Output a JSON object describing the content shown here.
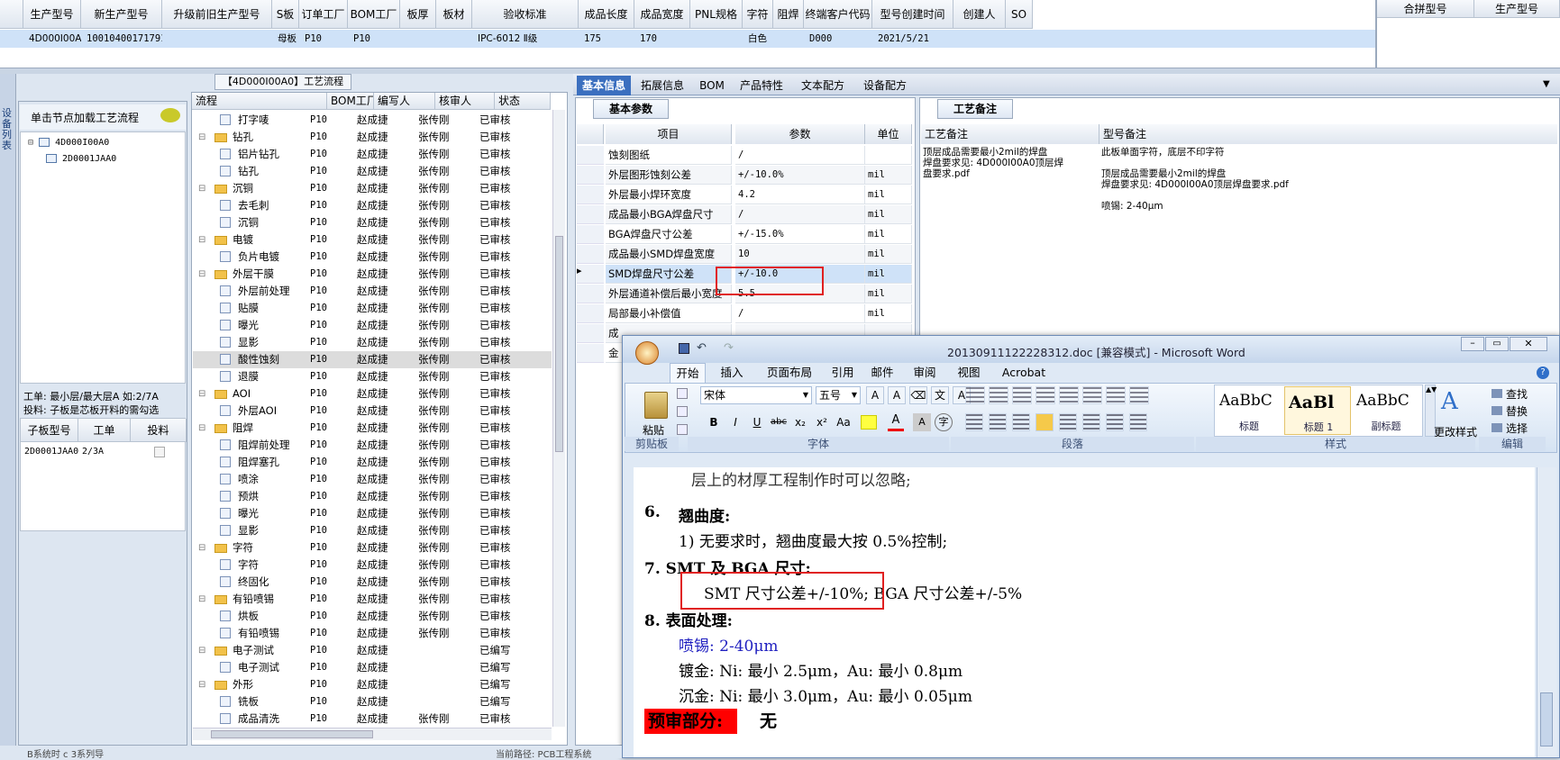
{
  "top_grid": {
    "headers": [
      "生产型号",
      "新生产型号",
      "升级前旧生产型号",
      "S板",
      "订单工厂",
      "BOM工厂",
      "板厚",
      "板材",
      "验收标准",
      "成品长度",
      "成品宽度",
      "PNL规格",
      "字符",
      "阻焊",
      "终端客户代码",
      "型号创建时间",
      "创建人",
      "SO"
    ],
    "row": [
      "4D000I00A0",
      "10010400171791",
      "",
      "母板",
      "P10",
      "P10",
      "",
      "",
      "IPC-6012 Ⅱ级",
      "175",
      "170",
      "",
      "白色",
      "",
      "D000",
      "2021/5/21",
      "",
      ""
    ],
    "right_headers": [
      "合拼型号",
      "生产型号"
    ]
  },
  "left_panel": {
    "vertical_label": "设备列表",
    "hint": "单击节点加载工艺流程",
    "tree": [
      "4D000I00A0",
      "2D0001JAA0"
    ],
    "info_line1": "工单: 最小层/最大层A 如:2/7A",
    "info_line2": "投料: 子板是芯板开料的需勾选",
    "sub_headers": [
      "子板型号",
      "工单",
      "投料"
    ],
    "sub_row": [
      "2D0001JAA0",
      "2/3A",
      ""
    ]
  },
  "process": {
    "title": "【4D000I00A0】工艺流程",
    "headers": [
      "流程",
      "BOM工厂",
      "编写人",
      "核审人",
      "状态"
    ],
    "rows": [
      {
        "name": "打字唛",
        "level": 2,
        "bom": "P10",
        "writer": "赵成捷",
        "reviewer": "张传刚",
        "status": "已审核"
      },
      {
        "name": "钻孔",
        "level": 1,
        "bom": "P10",
        "writer": "赵成捷",
        "reviewer": "张传刚",
        "status": "已审核"
      },
      {
        "name": "铝片钻孔",
        "level": 2,
        "bom": "P10",
        "writer": "赵成捷",
        "reviewer": "张传刚",
        "status": "已审核"
      },
      {
        "name": "钻孔",
        "level": 2,
        "bom": "P10",
        "writer": "赵成捷",
        "reviewer": "张传刚",
        "status": "已审核"
      },
      {
        "name": "沉铜",
        "level": 1,
        "bom": "P10",
        "writer": "赵成捷",
        "reviewer": "张传刚",
        "status": "已审核"
      },
      {
        "name": "去毛刺",
        "level": 2,
        "bom": "P10",
        "writer": "赵成捷",
        "reviewer": "张传刚",
        "status": "已审核"
      },
      {
        "name": "沉铜",
        "level": 2,
        "bom": "P10",
        "writer": "赵成捷",
        "reviewer": "张传刚",
        "status": "已审核"
      },
      {
        "name": "电镀",
        "level": 1,
        "bom": "P10",
        "writer": "赵成捷",
        "reviewer": "张传刚",
        "status": "已审核"
      },
      {
        "name": "负片电镀",
        "level": 2,
        "bom": "P10",
        "writer": "赵成捷",
        "reviewer": "张传刚",
        "status": "已审核"
      },
      {
        "name": "外层干膜",
        "level": 1,
        "bom": "P10",
        "writer": "赵成捷",
        "reviewer": "张传刚",
        "status": "已审核"
      },
      {
        "name": "外层前处理",
        "level": 2,
        "bom": "P10",
        "writer": "赵成捷",
        "reviewer": "张传刚",
        "status": "已审核"
      },
      {
        "name": "贴膜",
        "level": 2,
        "bom": "P10",
        "writer": "赵成捷",
        "reviewer": "张传刚",
        "status": "已审核"
      },
      {
        "name": "曝光",
        "level": 2,
        "bom": "P10",
        "writer": "赵成捷",
        "reviewer": "张传刚",
        "status": "已审核"
      },
      {
        "name": "显影",
        "level": 2,
        "bom": "P10",
        "writer": "赵成捷",
        "reviewer": "张传刚",
        "status": "已审核"
      },
      {
        "name": "酸性蚀刻",
        "level": 2,
        "bom": "P10",
        "writer": "赵成捷",
        "reviewer": "张传刚",
        "status": "已审核",
        "selected": true
      },
      {
        "name": "退膜",
        "level": 2,
        "bom": "P10",
        "writer": "赵成捷",
        "reviewer": "张传刚",
        "status": "已审核"
      },
      {
        "name": "AOI",
        "level": 1,
        "bom": "P10",
        "writer": "赵成捷",
        "reviewer": "张传刚",
        "status": "已审核"
      },
      {
        "name": "外层AOI",
        "level": 2,
        "bom": "P10",
        "writer": "赵成捷",
        "reviewer": "张传刚",
        "status": "已审核"
      },
      {
        "name": "阻焊",
        "level": 1,
        "bom": "P10",
        "writer": "赵成捷",
        "reviewer": "张传刚",
        "status": "已审核"
      },
      {
        "name": "阻焊前处理",
        "level": 2,
        "bom": "P10",
        "writer": "赵成捷",
        "reviewer": "张传刚",
        "status": "已审核"
      },
      {
        "name": "阻焊塞孔",
        "level": 2,
        "bom": "P10",
        "writer": "赵成捷",
        "reviewer": "张传刚",
        "status": "已审核"
      },
      {
        "name": "喷涂",
        "level": 2,
        "bom": "P10",
        "writer": "赵成捷",
        "reviewer": "张传刚",
        "status": "已审核"
      },
      {
        "name": "预烘",
        "level": 2,
        "bom": "P10",
        "writer": "赵成捷",
        "reviewer": "张传刚",
        "status": "已审核"
      },
      {
        "name": "曝光",
        "level": 2,
        "bom": "P10",
        "writer": "赵成捷",
        "reviewer": "张传刚",
        "status": "已审核"
      },
      {
        "name": "显影",
        "level": 2,
        "bom": "P10",
        "writer": "赵成捷",
        "reviewer": "张传刚",
        "status": "已审核"
      },
      {
        "name": "字符",
        "level": 1,
        "bom": "P10",
        "writer": "赵成捷",
        "reviewer": "张传刚",
        "status": "已审核"
      },
      {
        "name": "字符",
        "level": 2,
        "bom": "P10",
        "writer": "赵成捷",
        "reviewer": "张传刚",
        "status": "已审核"
      },
      {
        "name": "终固化",
        "level": 2,
        "bom": "P10",
        "writer": "赵成捷",
        "reviewer": "张传刚",
        "status": "已审核"
      },
      {
        "name": "有铅喷锡",
        "level": 1,
        "bom": "P10",
        "writer": "赵成捷",
        "reviewer": "张传刚",
        "status": "已审核"
      },
      {
        "name": "烘板",
        "level": 2,
        "bom": "P10",
        "writer": "赵成捷",
        "reviewer": "张传刚",
        "status": "已审核"
      },
      {
        "name": "有铅喷锡",
        "level": 2,
        "bom": "P10",
        "writer": "赵成捷",
        "reviewer": "张传刚",
        "status": "已审核"
      },
      {
        "name": "电子测试",
        "level": 1,
        "bom": "P10",
        "writer": "赵成捷",
        "reviewer": "",
        "status": "已编写"
      },
      {
        "name": "电子测试",
        "level": 2,
        "bom": "P10",
        "writer": "赵成捷",
        "reviewer": "",
        "status": "已编写"
      },
      {
        "name": "外形",
        "level": 1,
        "bom": "P10",
        "writer": "赵成捷",
        "reviewer": "",
        "status": "已编写"
      },
      {
        "name": "铣板",
        "level": 2,
        "bom": "P10",
        "writer": "赵成捷",
        "reviewer": "",
        "status": "已编写"
      },
      {
        "name": "成品清洗",
        "level": 2,
        "bom": "P10",
        "writer": "赵成捷",
        "reviewer": "张传刚",
        "status": "已审核"
      }
    ]
  },
  "tabs": [
    "基本信息",
    "拓展信息",
    "BOM",
    "产品特性",
    "文本配方",
    "设备配方"
  ],
  "basic": {
    "tab": "基本参数",
    "headers": [
      "项目",
      "参数",
      "单位"
    ],
    "rows": [
      {
        "item": "蚀刻图纸",
        "value": "/",
        "unit": ""
      },
      {
        "item": "外层图形蚀刻公差",
        "value": "+/-10.0%",
        "unit": "mil"
      },
      {
        "item": "外层最小焊环宽度",
        "value": "4.2",
        "unit": "mil"
      },
      {
        "item": "成品最小BGA焊盘尺寸",
        "value": "/",
        "unit": "mil"
      },
      {
        "item": "BGA焊盘尺寸公差",
        "value": "+/-15.0%",
        "unit": "mil"
      },
      {
        "item": "成品最小SMD焊盘宽度",
        "value": "10",
        "unit": "mil"
      },
      {
        "item": "SMD焊盘尺寸公差",
        "value": "+/-10.0",
        "unit": "mil"
      },
      {
        "item": "外层通道补偿后最小宽度",
        "value": "5.5",
        "unit": "mil"
      },
      {
        "item": "局部最小补偿值",
        "value": "/",
        "unit": "mil"
      },
      {
        "item": "成",
        "value": "",
        "unit": ""
      },
      {
        "item": "金",
        "value": "",
        "unit": ""
      }
    ]
  },
  "notes": {
    "tab": "工艺备注",
    "col1": "工艺备注",
    "col2": "型号备注",
    "text1": [
      "顶层成品需要最小2mil的焊盘",
      "焊盘要求见: 4D000I00A0顶层焊",
      "盘要求.pdf"
    ],
    "text2": [
      "此板单面字符，底层不印字符",
      "",
      "顶层成品需要最小2mil的焊盘",
      "焊盘要求见: 4D000I00A0顶层焊盘要求.pdf",
      "",
      "喷锡: 2-40μm"
    ]
  },
  "word": {
    "title": "20130911122228312.doc [兼容模式] - Microsoft Word",
    "tabs": [
      "开始",
      "插入",
      "页面布局",
      "引用",
      "邮件",
      "审阅",
      "视图",
      "Acrobat"
    ],
    "font": "宋体",
    "size": "五号",
    "paste": "粘贴",
    "groups": [
      "剪贴板",
      "字体",
      "段落",
      "样式",
      "编辑"
    ],
    "styles": [
      {
        "preview": "AaBbC",
        "label": "标题"
      },
      {
        "preview": "AaBl",
        "label": "标题 1"
      },
      {
        "preview": "AaBbC",
        "label": "副标题"
      }
    ],
    "change_styles": "更改样式",
    "edit": [
      "查找",
      "替换",
      "选择"
    ],
    "doc_lines": {
      "l0": "层上的材厚工程制作时可以忽略;",
      "l1_num": "6.",
      "l1": "翘曲度:",
      "l2": "1)  无要求时，翘曲度最大按 0.5%控制;",
      "l3": "7. SMT 及 BGA 尺寸:",
      "l4": "SMT 尺寸公差+/-10%; BGA 尺寸公差+/-5%",
      "l5": "8. 表面处理:",
      "l6": "喷锡: 2-40μm",
      "l7": "镀金: Ni: 最小 2.5μm，Au: 最小 0.8μm",
      "l8": "沉金: Ni: 最小 3.0μm，Au: 最小 0.05μm",
      "l9a": "预审部分:",
      "l9b": "无"
    }
  },
  "status_bar": {
    "left": "B系统时 c 3系列导",
    "right": "当前路径: PCB工程系统"
  }
}
